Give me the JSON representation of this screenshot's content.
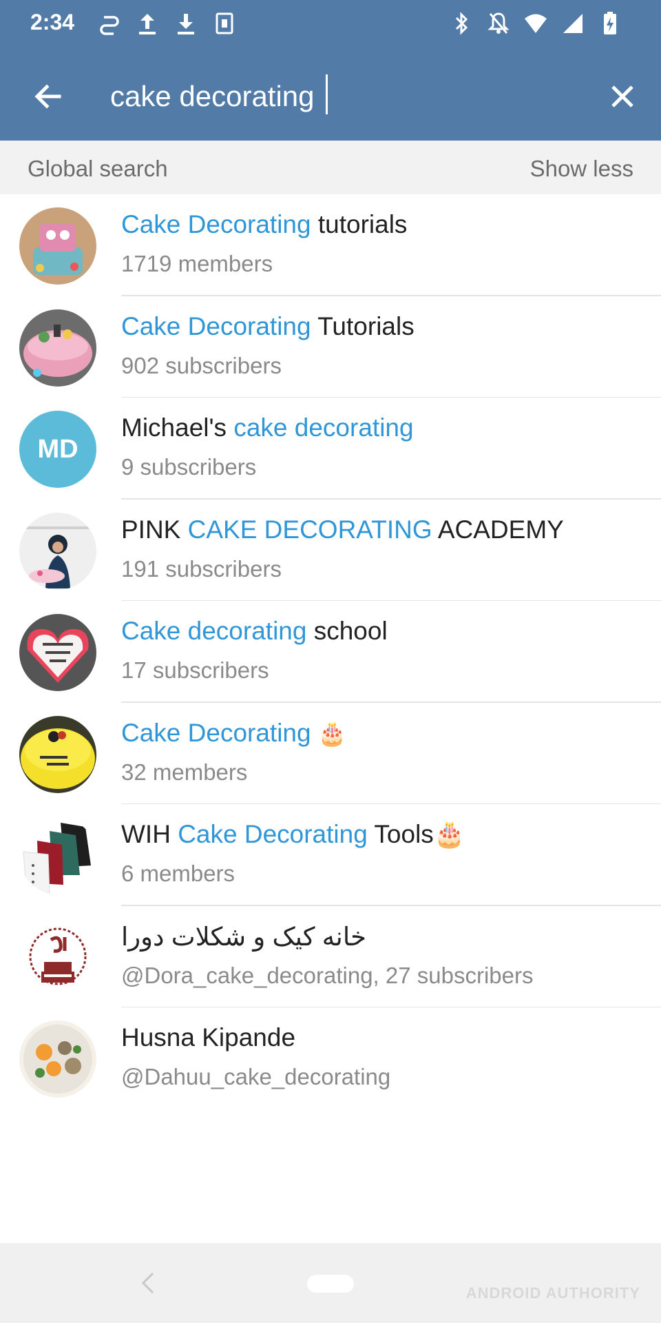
{
  "status_bar": {
    "time": "2:34",
    "left_icons": [
      "sync-icon",
      "upload-icon",
      "download-icon",
      "sim-icon"
    ],
    "right_icons": [
      "bluetooth-icon",
      "notifications-off-icon",
      "wifi-icon",
      "signal-icon",
      "battery-charging-icon"
    ]
  },
  "search": {
    "query": "cake decorating",
    "back_icon": "arrow-left-icon",
    "clear_icon": "close-icon"
  },
  "section": {
    "title": "Global search",
    "action": "Show less"
  },
  "results": [
    {
      "title_hl": "Cake Decorating",
      "title_rest": " tutorials",
      "subtitle": "1719 members",
      "avatar": "cake-photo"
    },
    {
      "title_hl": "Cake Decorating",
      "title_rest": " Tutorials",
      "subtitle": "902 subscribers",
      "avatar": "cake-photo"
    },
    {
      "title_pre": "Michael's ",
      "title_hl": "cake decorating",
      "subtitle": "9 subscribers",
      "avatar_initials": "MD",
      "avatar_color": "#5bbbd9"
    },
    {
      "title_pre": "PINK ",
      "title_hl": "CAKE DECORATING",
      "title_rest": " ACADEMY",
      "subtitle": "191 subscribers",
      "avatar": "person-photo"
    },
    {
      "title_hl": "Cake decorating",
      "title_rest": " school",
      "subtitle": "17 subscribers",
      "avatar": "cake-photo"
    },
    {
      "title_hl": "Cake Decorating",
      "title_rest": " 🎂",
      "subtitle": "32 members",
      "avatar": "yellow-cake-photo"
    },
    {
      "title_pre": "WIH ",
      "title_hl": "Cake Decorating",
      "title_rest": " Tools🎂",
      "subtitle": "6 members",
      "avatar": "chef-jackets-photo"
    },
    {
      "title_pre": "خانه کیک و شکلات دورا",
      "subtitle": "@Dora_cake_decorating, 27 subscribers",
      "avatar": "dora-logo"
    },
    {
      "title_pre": "Husna Kipande",
      "subtitle": "@Dahuu_cake_decorating",
      "avatar": "food-photo"
    }
  ],
  "navbar": {
    "back_icon": "nav-back-icon",
    "home_icon": "nav-home-pill",
    "watermark": "ANDROID AUTHORITY"
  },
  "colors": {
    "header": "#527ca7",
    "highlight": "#2f96d8",
    "md_avatar": "#5bbbd9"
  }
}
